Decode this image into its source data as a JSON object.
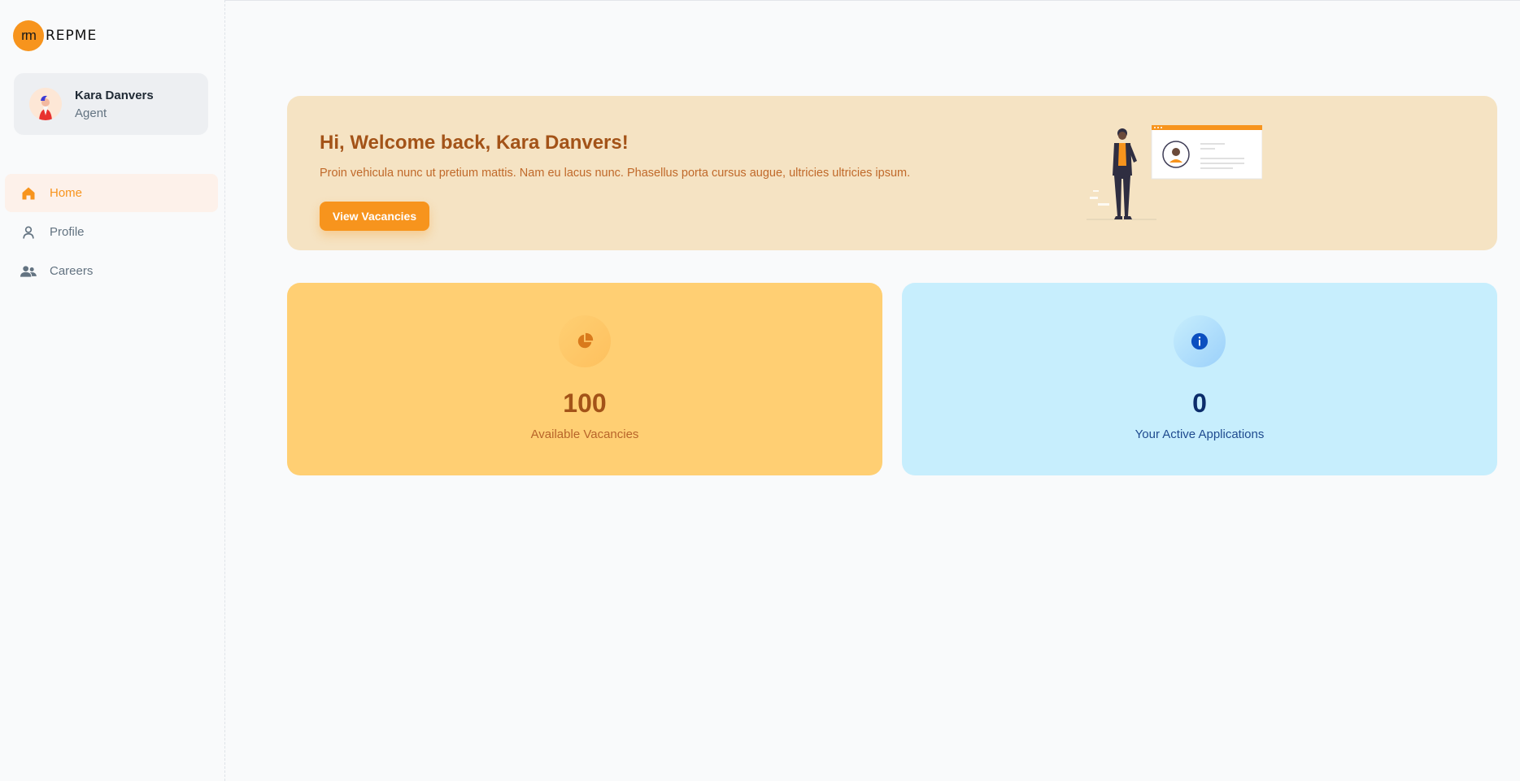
{
  "brand": {
    "mark": "rm",
    "word": "REPME",
    "accent": "#f7941d"
  },
  "account": {
    "name": "Kara Danvers",
    "role": "Agent"
  },
  "nav": {
    "items": [
      {
        "label": "Home",
        "icon": "home-icon",
        "active": true
      },
      {
        "label": "Profile",
        "icon": "person-icon",
        "active": false
      },
      {
        "label": "Careers",
        "icon": "people-icon",
        "active": false
      }
    ]
  },
  "banner": {
    "title": "Hi, Welcome back, Kara Danvers!",
    "text": "Proin vehicula nunc ut pretium mattis. Nam eu lacus nunc. Phasellus porta cursus augue, ultricies ultricies ipsum.",
    "button_label": "View Vacancies",
    "illustration": "person-presenting-illustration"
  },
  "stats": [
    {
      "value": "100",
      "label": "Available Vacancies",
      "icon": "pie-chart-icon",
      "color": "#ffcf73"
    },
    {
      "value": "0",
      "label": "Your Active Applications",
      "icon": "info-icon",
      "color": "#c7eefd"
    }
  ]
}
